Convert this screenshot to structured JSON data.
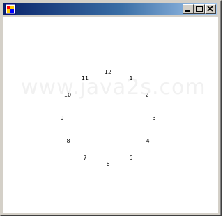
{
  "window": {
    "title": "",
    "colors": {
      "titlebar_start": "#0a246a",
      "titlebar_end": "#a6caf0",
      "chrome": "#d4d0c8",
      "client": "#ffffff"
    },
    "buttons": {
      "minimize_icon": "minimize-icon",
      "maximize_icon": "maximize-icon",
      "close_icon": "close-icon"
    }
  },
  "client": {
    "watermark": "www.java2s.com",
    "clock": {
      "hours": [
        "12",
        "1",
        "2",
        "3",
        "4",
        "5",
        "6",
        "7",
        "8",
        "9",
        "10",
        "11"
      ]
    }
  }
}
